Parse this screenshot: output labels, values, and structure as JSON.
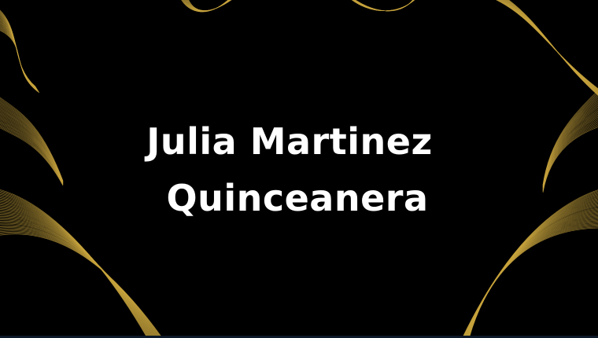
{
  "title": {
    "line1": "Julia Martinez",
    "line2": "Quinceanera"
  },
  "colors": {
    "background": "#000000",
    "text": "#ffffff",
    "wave": "#c9a53f"
  },
  "decoration": "gold-wave-lines"
}
